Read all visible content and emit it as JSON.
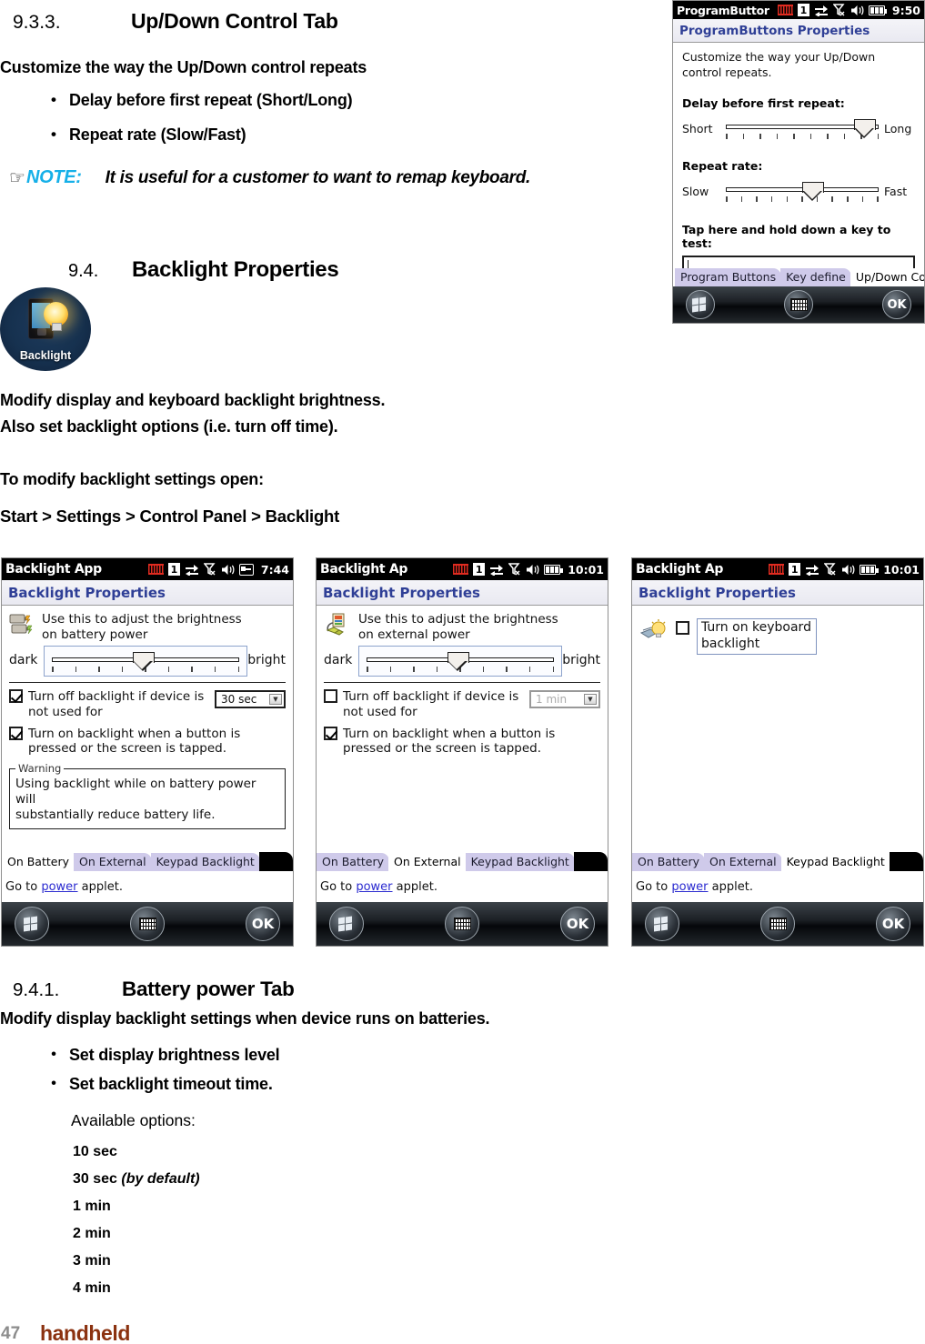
{
  "document": {
    "section_933": {
      "number": "9.3.3.",
      "title": "Up/Down Control Tab"
    },
    "p_customize": "Customize the way the Up/Down control repeats",
    "bullets_933": [
      "Delay before first repeat (Short/Long)",
      "Repeat rate (Slow/Fast)"
    ],
    "note": {
      "label": "NOTE:",
      "text": "It is useful for a customer to want to remap keyboard.",
      "color": "#16b0e8"
    },
    "section_94": {
      "number": "9.4.",
      "title": "Backlight Properties"
    },
    "desktop_icon": {
      "label": "Backlight"
    },
    "p_modify_1": "Modify display and keyboard backlight brightness.",
    "p_modify_2": "Also set backlight options (i.e. turn off time).",
    "p_to_modify": "To modify backlight settings open:",
    "p_path": "Start > Settings > Control Panel > Backlight",
    "section_941": {
      "number": "9.4.1.",
      "title": "Battery power Tab"
    },
    "p_modify_battery": "Modify display backlight settings when device runs on batteries.",
    "bullets_941": [
      "Set display brightness level",
      "Set backlight timeout time."
    ],
    "available_options_label": "Available options:",
    "options": [
      {
        "value": "10 sec",
        "note": ""
      },
      {
        "value": "30 sec",
        "note": "(by default)"
      },
      {
        "value": "1 min",
        "note": ""
      },
      {
        "value": "2 min",
        "note": ""
      },
      {
        "value": "3 min",
        "note": ""
      },
      {
        "value": "4 min",
        "note": ""
      }
    ],
    "footer": {
      "page_number": "47",
      "brand": "handheld",
      "brand_color": "#8b3210"
    }
  },
  "pda_program_buttons": {
    "titlebar": {
      "title": "ProgramButtor",
      "input_indicator": "1",
      "time": "9:50"
    },
    "header": "ProgramButtons Properties",
    "intro": "Customize the way your Up/Down control repeats.",
    "delay_label": "Delay before first repeat:",
    "delay_slider": {
      "min_label": "Short",
      "max_label": "Long",
      "value_percent": 86,
      "ticks": 10
    },
    "repeat_label": "Repeat rate:",
    "repeat_slider": {
      "min_label": "Slow",
      "max_label": "Fast",
      "value_percent": 55,
      "ticks": 11
    },
    "test_label": "Tap here and hold down a key to test:",
    "test_field_value": "",
    "tabs": [
      {
        "label": "Program Buttons",
        "active": false
      },
      {
        "label": "Key define",
        "active": false
      },
      {
        "label": "Up/Down Control",
        "active": true
      }
    ],
    "softkeys": {
      "start": "start-icon",
      "keyboard": "keyboard-icon",
      "ok": "OK"
    }
  },
  "pda_on_battery": {
    "titlebar": {
      "title": "Backlight App",
      "input_indicator": "1",
      "time": "7:44"
    },
    "header": "Backlight Properties",
    "brightness_text_line1": "Use this to adjust the brightness",
    "brightness_text_line2": "on battery power",
    "slider": {
      "min_label": "dark",
      "max_label": "bright",
      "value_percent": 46,
      "ticks": 9
    },
    "check_timeout": {
      "label_line1": "Turn off backlight if device is",
      "label_line2": "not used for",
      "checked": true
    },
    "timeout_value": "30 sec",
    "check_button": {
      "label_line1": "Turn on backlight when a button is",
      "label_line2": "pressed or the screen is tapped.",
      "checked": true
    },
    "warning": {
      "legend": "Warning",
      "line1": "Using backlight while on battery power will",
      "line2": "substantially reduce battery life."
    },
    "tabs": [
      {
        "label": "On Battery",
        "active": true
      },
      {
        "label": "On External",
        "active": false
      },
      {
        "label": "Keypad Backlight",
        "active": false
      }
    ],
    "goto": {
      "prefix": "Go to ",
      "link": "power",
      "suffix": " applet."
    },
    "softkeys": {
      "start": "start-icon",
      "keyboard": "keyboard-icon",
      "ok": "OK"
    }
  },
  "pda_on_external": {
    "titlebar": {
      "title": "Backlight Ap",
      "input_indicator": "1",
      "time": "10:01"
    },
    "header": "Backlight Properties",
    "brightness_text_line1": "Use this to adjust the brightness",
    "brightness_text_line2": "on external power",
    "slider": {
      "min_label": "dark",
      "max_label": "bright",
      "value_percent": 46,
      "ticks": 9
    },
    "check_timeout": {
      "label_line1": "Turn off backlight if device is",
      "label_line2": "not used for",
      "checked": false
    },
    "timeout_value": "1 min",
    "check_button": {
      "label_line1": "Turn on backlight when a button is",
      "label_line2": "pressed or the screen is tapped.",
      "checked": true
    },
    "tabs": [
      {
        "label": "On Battery",
        "active": false
      },
      {
        "label": "On External",
        "active": true
      },
      {
        "label": "Keypad Backlight",
        "active": false
      }
    ],
    "goto": {
      "prefix": "Go to ",
      "link": "power",
      "suffix": " applet."
    },
    "softkeys": {
      "start": "start-icon",
      "keyboard": "keyboard-icon",
      "ok": "OK"
    }
  },
  "pda_keypad_backlight": {
    "titlebar": {
      "title": "Backlight Ap",
      "input_indicator": "1",
      "time": "10:01"
    },
    "header": "Backlight Properties",
    "check_keyboard": {
      "label_line1": "Turn on keyboard",
      "label_line2": "backlight",
      "checked": false
    },
    "tabs": [
      {
        "label": "On Battery",
        "active": false
      },
      {
        "label": "On External",
        "active": false
      },
      {
        "label": "Keypad Backlight",
        "active": true
      }
    ],
    "goto": {
      "prefix": "Go to ",
      "link": "power",
      "suffix": " applet."
    },
    "softkeys": {
      "start": "start-icon",
      "keyboard": "keyboard-icon",
      "ok": "OK"
    }
  }
}
